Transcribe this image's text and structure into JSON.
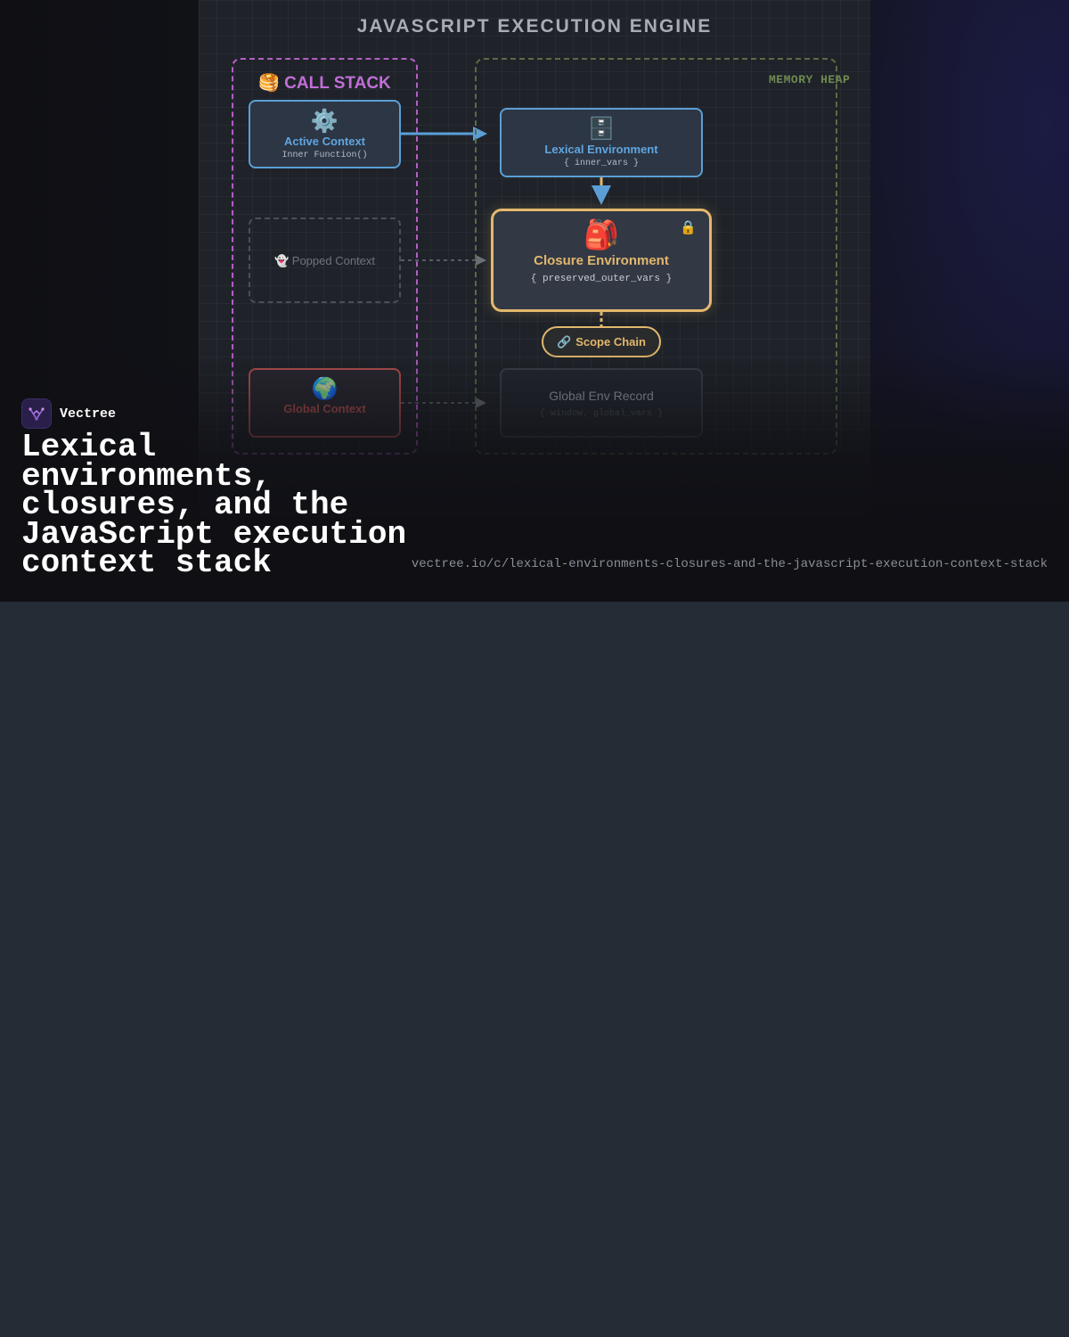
{
  "diagram": {
    "title": "JAVASCRIPT EXECUTION ENGINE",
    "call_stack": {
      "icon": "🥞",
      "label": "CALL STACK",
      "active": {
        "icon": "⚙️",
        "label": "Active Context",
        "sub": "Inner Function()"
      },
      "popped": {
        "icon": "👻",
        "label": "Popped Context"
      },
      "global": {
        "icon": "🌍",
        "label": "Global Context"
      }
    },
    "memory_heap": {
      "label": "MEMORY HEAP",
      "lexical": {
        "icon": "🗄️",
        "label": "Lexical Environment",
        "sub": "{ inner_vars }"
      },
      "closure": {
        "icon": "🎒",
        "lock_icon": "🔒",
        "label": "Closure Environment",
        "sub": "{ preserved_outer_vars }"
      },
      "scope_chain": {
        "icon": "🔗",
        "label": "Scope Chain"
      },
      "global_record": {
        "label": "Global Env Record",
        "sub": "{ window, global_vars }"
      }
    },
    "colors": {
      "active": "#5b9fd6",
      "stack": "#c06fd6",
      "closure": "#e2b86c",
      "global": "#b5504f",
      "heap": "#6f8a52"
    }
  },
  "brand": {
    "name": "Vectree",
    "logo_icon": "vectree-logo-icon"
  },
  "headline": "Lexical environments, closures, and the JavaScript execution context stack",
  "url": "vectree.io/c/lexical-environments-closures-and-the-javascript-execution-context-stack"
}
